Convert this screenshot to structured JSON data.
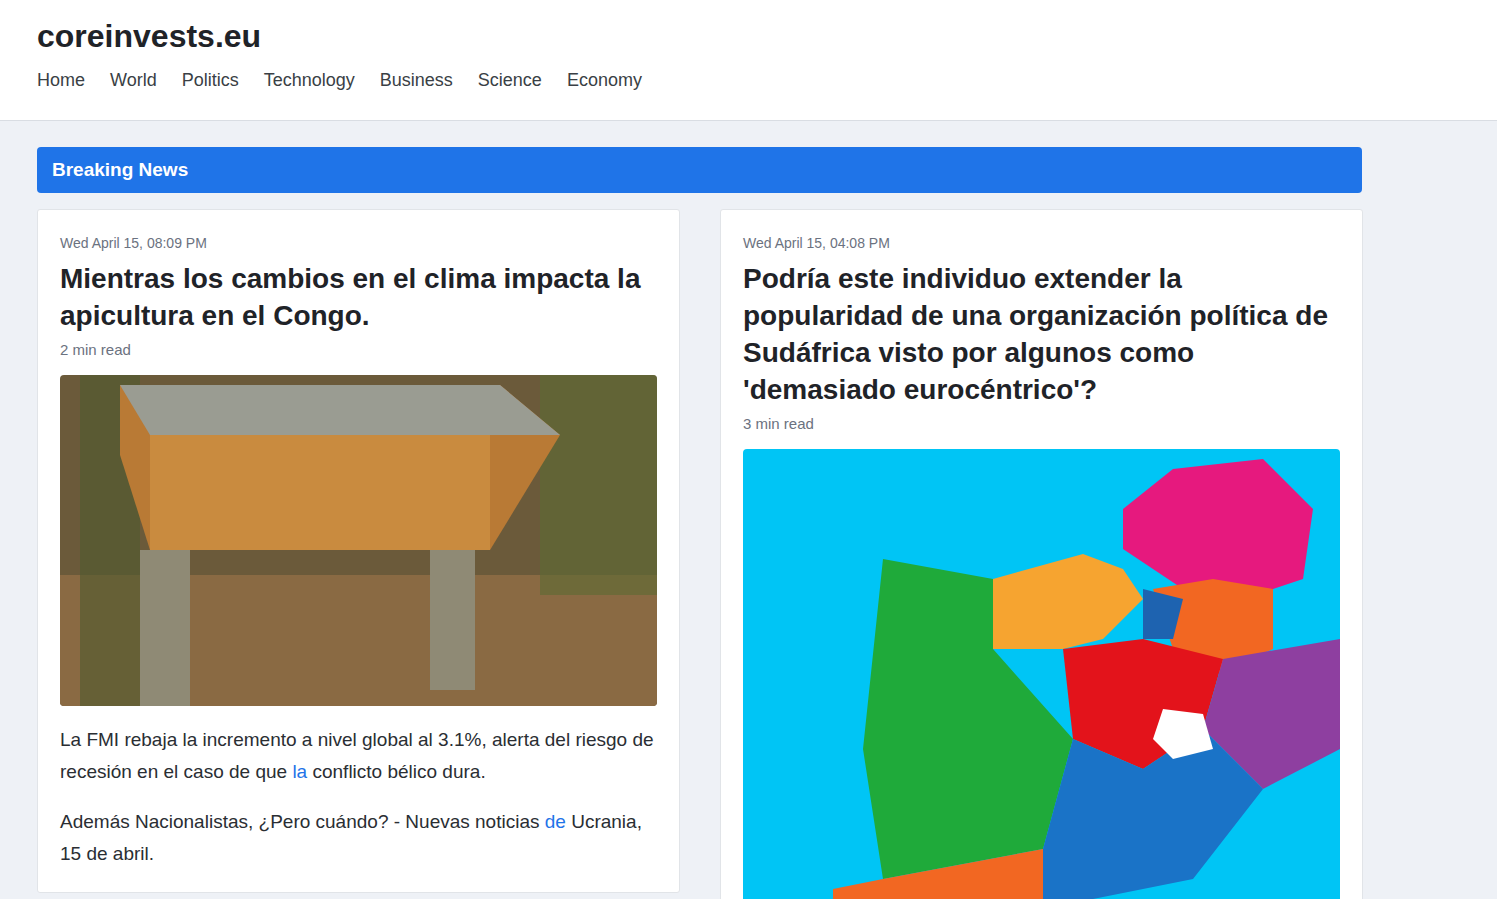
{
  "site": {
    "logo": "coreinvests.eu"
  },
  "nav": [
    "Home",
    "World",
    "Politics",
    "Technology",
    "Business",
    "Science",
    "Economy"
  ],
  "banner": "Breaking News",
  "articles": [
    {
      "date": "Wed April 15, 08:09 PM",
      "title": "Mientras los cambios en el clima impacta la apicultura en el Congo.",
      "read_time": "2 min read",
      "image": "photo",
      "paragraphs": [
        [
          {
            "text": "La FMI rebaja la incremento a nivel global al 3.1%, alerta del riesgo de recesión en el caso de que ",
            "link": false
          },
          {
            "text": "la",
            "link": true
          },
          {
            "text": " conflicto bélico dura.",
            "link": false
          }
        ],
        [
          {
            "text": "Además Nacionalistas, ¿Pero cuándo? - Nuevas noticias ",
            "link": false
          },
          {
            "text": "de",
            "link": true
          },
          {
            "text": " Ucrania, 15 de abril.",
            "link": false
          }
        ]
      ]
    },
    {
      "date": "Wed April 15, 04:08 PM",
      "title": "Podría este individuo extender la popularidad de una organización política de Sudáfrica visto por algunos como 'demasiado eurocéntrico'?",
      "read_time": "3 min read",
      "image": "map",
      "paragraphs": []
    }
  ]
}
